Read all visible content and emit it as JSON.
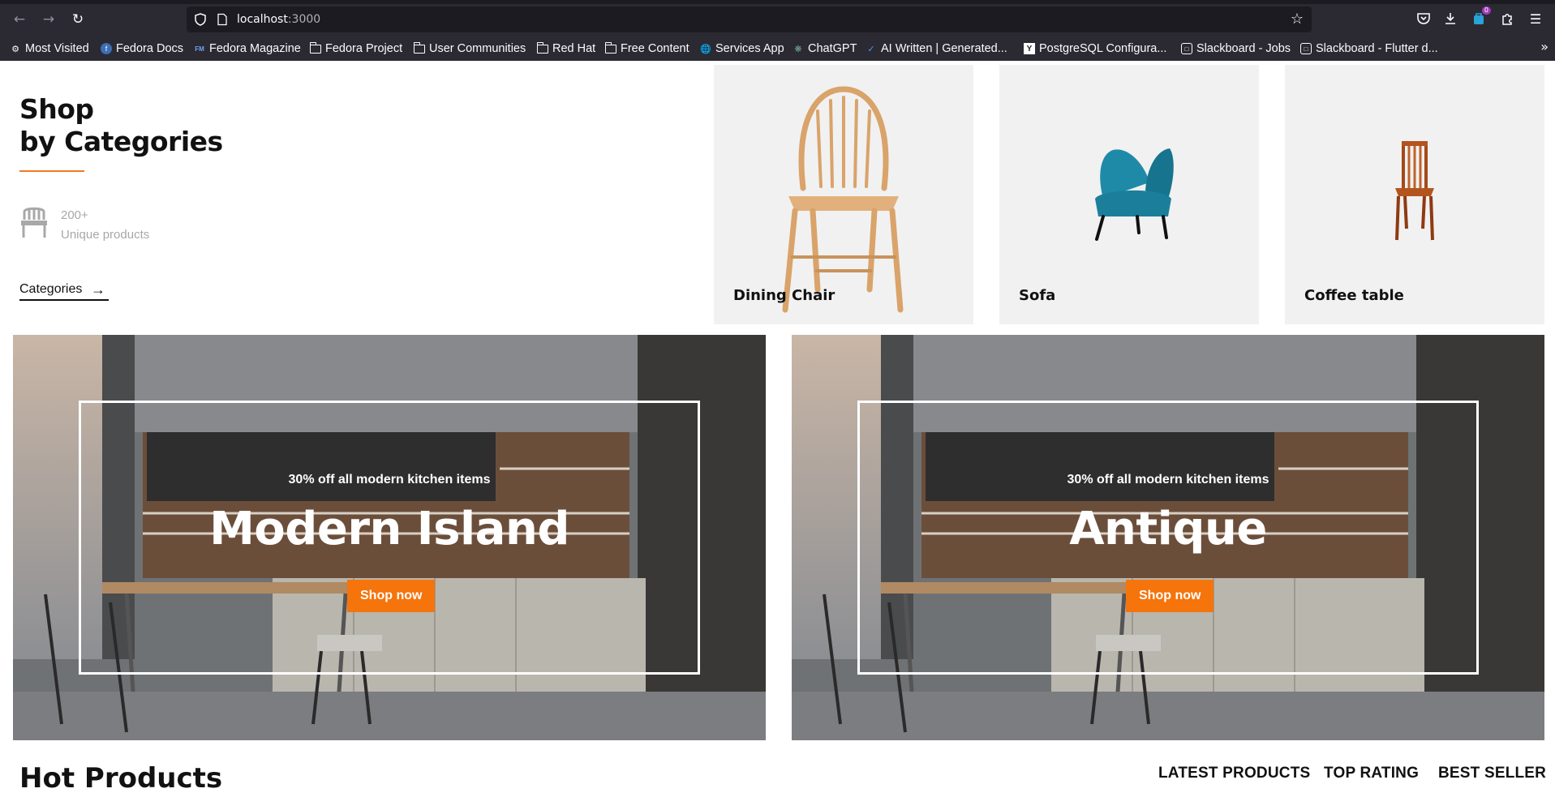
{
  "browser": {
    "url_host": "localhost",
    "url_port": ":3000",
    "extension_badge": "0",
    "bookmarks": [
      {
        "label": "Most Visited",
        "icon": "gear-icon"
      },
      {
        "label": "Fedora Docs",
        "icon": "fedora-icon"
      },
      {
        "label": "Fedora Magazine",
        "icon": "fm-icon"
      },
      {
        "label": "Fedora Project",
        "icon": "folder-icon"
      },
      {
        "label": "User Communities",
        "icon": "folder-icon"
      },
      {
        "label": "Red Hat",
        "icon": "folder-icon"
      },
      {
        "label": "Free Content",
        "icon": "folder-icon"
      },
      {
        "label": "Services App",
        "icon": "globe-icon"
      },
      {
        "label": "ChatGPT",
        "icon": "chatgpt-icon"
      },
      {
        "label": "AI Written | Generated...",
        "icon": "check-icon"
      },
      {
        "label": "PostgreSQL Configura...",
        "icon": "y-icon"
      },
      {
        "label": "Slackboard - Jobs",
        "icon": "slackboard-icon"
      },
      {
        "label": "Slackboard - Flutter d...",
        "icon": "slackboard-icon"
      }
    ]
  },
  "categories_section": {
    "title_line1": "Shop",
    "title_line2": "by Categories",
    "stat_number": "200+",
    "stat_label": "Unique products",
    "link_label": "Categories",
    "accent_color": "#f07a22"
  },
  "category_cards": [
    {
      "name": "Dining Chair"
    },
    {
      "name": "Sofa"
    },
    {
      "name": "Coffee table"
    }
  ],
  "banners": [
    {
      "subtitle": "30% off all modern kitchen items",
      "headline": "Modern Island",
      "button": "Shop now"
    },
    {
      "subtitle": "30% off all modern kitchen items",
      "headline": "Antique",
      "button": "Shop now"
    }
  ],
  "hot_products": {
    "title": "Hot Products",
    "tabs": [
      "LATEST PRODUCTS",
      "TOP RATING",
      "BEST SELLER"
    ]
  },
  "colors": {
    "button": "#f5740c",
    "chrome": "#2b2a33"
  }
}
